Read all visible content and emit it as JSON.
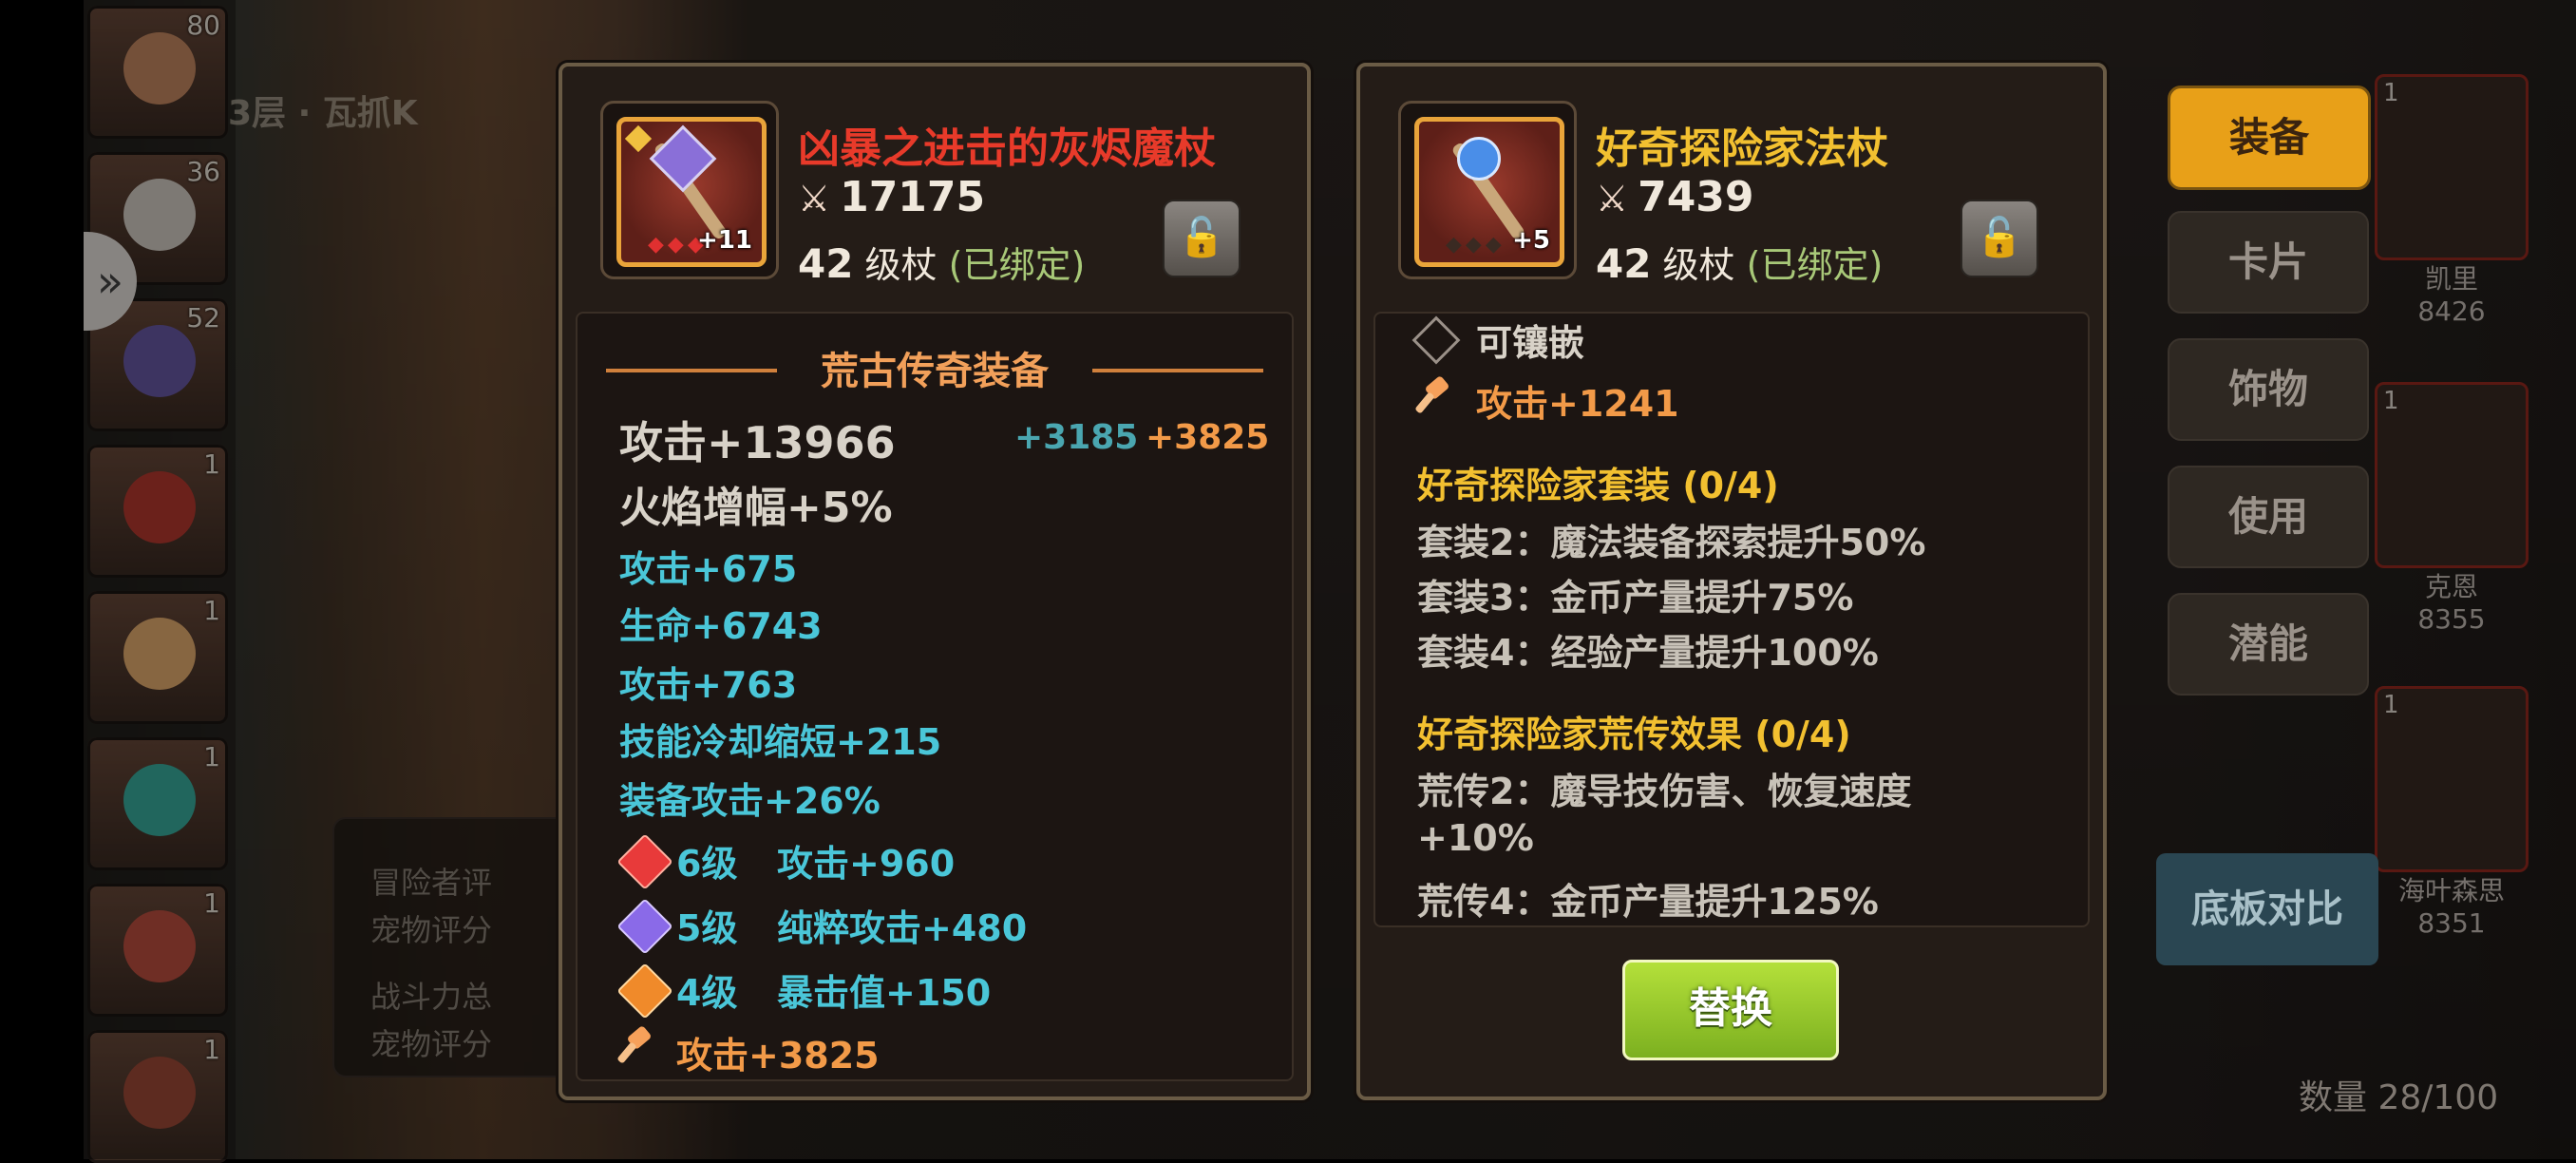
{
  "background": {
    "stage_title": "3层 · 瓦抓K",
    "roster_levels": [
      "80",
      "36",
      "52",
      "1",
      "1",
      "1",
      "1",
      "1"
    ],
    "score_lines": [
      "冒险者评",
      "宠物评分",
      "战斗力总",
      "宠物评分"
    ]
  },
  "item_a": {
    "name": "凶暴之进击的灰烬魔杖",
    "name_color": "#e83a2a",
    "enhance": "+11",
    "power": "17175",
    "level": "42",
    "type": "级杖",
    "bound": "(已绑定)",
    "section_title": "荒古传奇装备",
    "main_attack": "攻击+13966",
    "bonus_1": "+3185",
    "bonus_2": "+3825",
    "fire_boost": "火焰增幅+5%",
    "stats": [
      "攻击+675",
      "生命+6743",
      "攻击+763",
      "技能冷却缩短+215",
      "装备攻击+26%"
    ],
    "gems": [
      {
        "level": "6级",
        "effect": "攻击+960",
        "color": "#e83a3a"
      },
      {
        "level": "5级",
        "effect": "纯粹攻击+480",
        "color": "#8a6ae8"
      },
      {
        "level": "4级",
        "effect": "暴击值+150",
        "color": "#f08a2a"
      }
    ],
    "forge": "攻击+3825"
  },
  "item_b": {
    "name": "好奇探险家法杖",
    "name_color": "#f2c030",
    "enhance": "+5",
    "power": "7439",
    "level": "42",
    "type": "级杖",
    "bound": "(已绑定)",
    "socket": "可镶嵌",
    "forge": "攻击+1241",
    "set_title": "好奇探险家套装 (0/4)",
    "set_effects": [
      "套装2：魔法装备探索提升50%",
      "套装3：金币产量提升75%",
      "套装4：经验产量提升100%"
    ],
    "legend_title": "好奇探险家荒传效果 (0/4)",
    "legend_effects": [
      "荒传2：魔导技伤害、恢复速度",
      "+10%",
      "荒传4：金币产量提升125%"
    ],
    "replace_label": "替换"
  },
  "side_menu": {
    "equip": "装备",
    "card": "卡片",
    "accessory": "饰物",
    "use": "使用",
    "potential": "潜能",
    "compare": "底板对比"
  },
  "heroes": [
    {
      "level": "1",
      "name": "凯里",
      "score": "8426"
    },
    {
      "level": "1",
      "name": "克恩",
      "score": "8355"
    },
    {
      "level": "1",
      "name": "海叶森思",
      "score": "8351"
    }
  ],
  "count": "数量 28/100"
}
